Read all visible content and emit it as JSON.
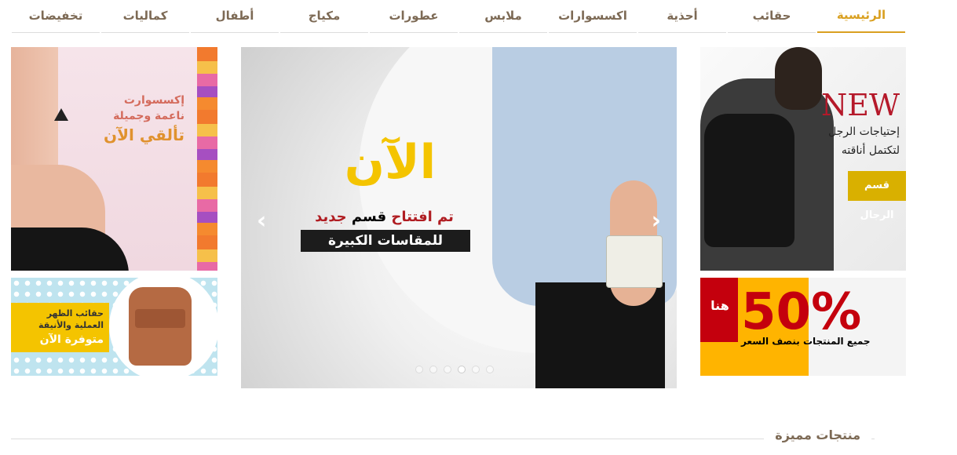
{
  "nav": {
    "items": [
      {
        "label": "الرئيسية",
        "active": true
      },
      {
        "label": "حقائب"
      },
      {
        "label": "أحذية"
      },
      {
        "label": "اكسسوارات"
      },
      {
        "label": "ملابس"
      },
      {
        "label": "عطورات"
      },
      {
        "label": "مكياج"
      },
      {
        "label": "أطفال"
      },
      {
        "label": "كماليات"
      },
      {
        "label": "تخفيضات"
      }
    ]
  },
  "banners": {
    "accessories": {
      "line1": "إكسسوارت",
      "line2": "ناعمة وجميلة",
      "line3": "تألقي الآن"
    },
    "backpacks": {
      "line1": "حقائب الظهر",
      "line2": "العملية والأنيقة",
      "line3": "متوفرة الآن"
    },
    "men": {
      "new": "NEW",
      "line1": "إحتياجات الرجل",
      "line2": "لتكتمل أناقته",
      "tag": "قسم الرجال"
    },
    "sale": {
      "huna": "هنا",
      "percent": "50%",
      "desc": "جميع المنتجات بنصف السعر"
    }
  },
  "slider": {
    "headline": "الآن",
    "line_part1": "تم افتتاح",
    "line_part2": "قسم",
    "line_part3": "جديد",
    "big_label": "للمقاسات الكبيرة",
    "prev_icon": "‹",
    "next_icon": "›",
    "dots_count": 6,
    "active_dot": 4
  },
  "featured": {
    "title": "منتجات مميزة"
  },
  "colors": {
    "accent": "#d9a021",
    "nav_text": "#7d6a55",
    "sale_red": "#c4000d",
    "sale_yellow": "#ffb400"
  }
}
